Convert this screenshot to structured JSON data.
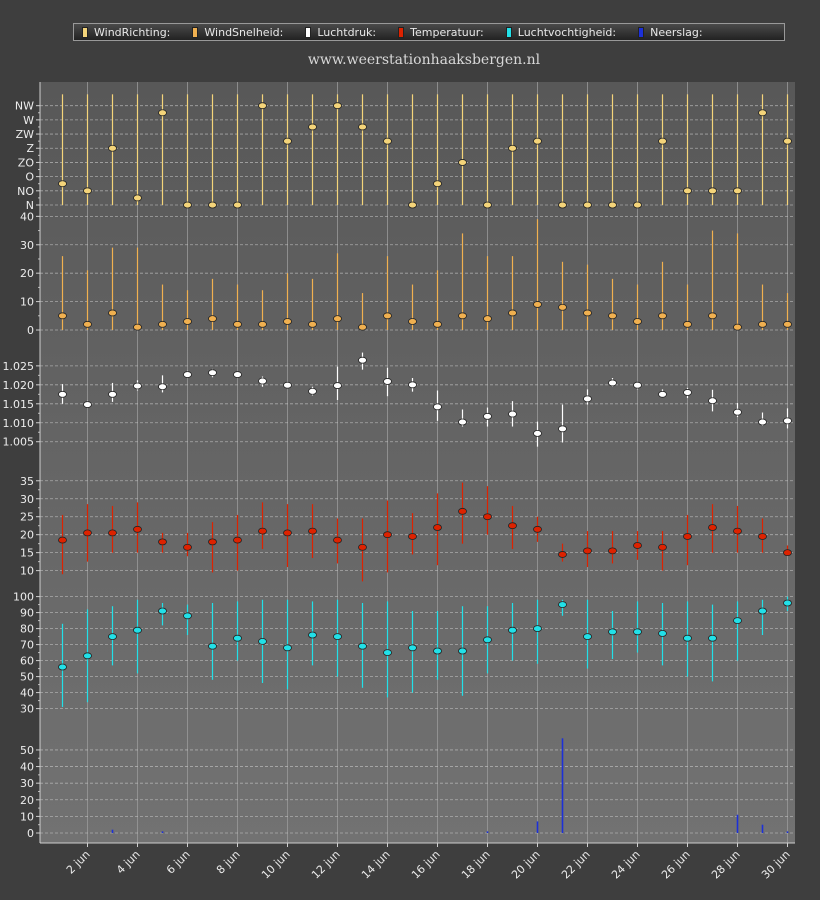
{
  "site_title": "www.weerstationhaaksbergen.nl",
  "legend": [
    {
      "label": "WindRichting:",
      "color": "#f4d47a"
    },
    {
      "label": "WindSnelheid:",
      "color": "#f0b050"
    },
    {
      "label": "Luchtdruk:",
      "color": "#ffffff"
    },
    {
      "label": "Temperatuur:",
      "color": "#dd2200"
    },
    {
      "label": "Luchtvochtigheid:",
      "color": "#22e0e8"
    },
    {
      "label": "Neerslag:",
      "color": "#1c30d8"
    }
  ],
  "chart_data": {
    "type": "scatter",
    "x": [
      1,
      2,
      3,
      4,
      5,
      6,
      7,
      8,
      9,
      10,
      11,
      12,
      13,
      14,
      15,
      16,
      17,
      18,
      19,
      20,
      21,
      22,
      23,
      24,
      25,
      26,
      27,
      28,
      29,
      30
    ],
    "x_tick_labels": [
      "2 jun",
      "4 jun",
      "6 jun",
      "8 jun",
      "10 jun",
      "12 jun",
      "14 jun",
      "16 jun",
      "18 jun",
      "20 jun",
      "22 jun",
      "24 jun",
      "26 jun",
      "28 jun",
      "30 jun"
    ],
    "x_tick_values": [
      2,
      4,
      6,
      8,
      10,
      12,
      14,
      16,
      18,
      20,
      22,
      24,
      26,
      28,
      30
    ],
    "xlim": [
      0.1,
      30.3
    ],
    "grid": true,
    "panels": [
      {
        "name": "WindRichting",
        "kind": "range-dot",
        "color": "#f4d47a",
        "ylim": [
          0,
          7.4
        ],
        "y_tick_labels": [
          "N",
          "NO",
          "O",
          "ZO",
          "Z",
          "ZW",
          "W",
          "NW"
        ],
        "y_tick_values": [
          0,
          1,
          2,
          3,
          4,
          5,
          6,
          7
        ],
        "values": [
          1.5,
          1,
          4,
          0.5,
          6.5,
          0,
          0,
          0,
          7,
          4.5,
          5.5,
          7,
          5.5,
          4.5,
          0,
          1.5,
          3,
          0,
          4,
          4.5,
          0,
          0,
          0,
          0,
          4.5,
          1,
          1,
          1,
          6.5,
          4.5
        ],
        "low": [
          0,
          0,
          0,
          0,
          0,
          0,
          0,
          0,
          0,
          0,
          0,
          0,
          0,
          0,
          0,
          0,
          0,
          0,
          0,
          0,
          0,
          0,
          0,
          0,
          0,
          0,
          0,
          0,
          0,
          0
        ],
        "high": [
          7.8,
          7.8,
          7.8,
          7.8,
          7.8,
          7.8,
          7.8,
          7.8,
          7.8,
          7.8,
          7.8,
          7.8,
          7.8,
          7.8,
          7.8,
          7.8,
          7.8,
          7.8,
          7.8,
          7.8,
          7.8,
          7.8,
          7.8,
          7.8,
          7.8,
          7.8,
          7.8,
          7.8,
          7.8,
          7.8
        ]
      },
      {
        "name": "WindSnelheid",
        "kind": "range-dot",
        "color": "#f0b050",
        "ylim": [
          0,
          44
        ],
        "y_tick_labels": [
          "0",
          "10",
          "20",
          "30",
          "40"
        ],
        "y_tick_values": [
          0,
          10,
          20,
          30,
          40
        ],
        "values": [
          5,
          2,
          6,
          1,
          2,
          3,
          4,
          2,
          2,
          3,
          2,
          4,
          1,
          5,
          3,
          2,
          5,
          4,
          6,
          9,
          8,
          6,
          5,
          3,
          5,
          2,
          5,
          1,
          2,
          2
        ],
        "low": [
          0,
          0,
          0,
          0,
          0,
          0,
          0,
          0,
          0,
          0,
          0,
          0,
          0,
          0,
          0,
          0,
          0,
          0,
          0,
          0,
          0,
          0,
          0,
          0,
          0,
          0,
          0,
          0,
          0,
          0
        ],
        "high": [
          26,
          21,
          29,
          29,
          16,
          14,
          18,
          16,
          14,
          20,
          18,
          27,
          13,
          26,
          16,
          21,
          34,
          26,
          26,
          39,
          24,
          23,
          18,
          16,
          24,
          16,
          35,
          34,
          16,
          13
        ]
      },
      {
        "name": "Luchtdruk",
        "kind": "range-dot",
        "color": "#ffffff",
        "ylim": [
          1.0015,
          1.0305
        ],
        "y_tick_labels": [
          "1.005",
          "1.010",
          "1.015",
          "1.020",
          "1.025"
        ],
        "y_tick_values": [
          1.005,
          1.01,
          1.015,
          1.02,
          1.025
        ],
        "values": [
          1.0175,
          1.0148,
          1.0175,
          1.0197,
          1.0195,
          1.0227,
          1.0232,
          1.0227,
          1.021,
          1.0199,
          1.0183,
          1.0198,
          1.0265,
          1.0209,
          1.02,
          1.0142,
          1.0102,
          1.0117,
          1.0123,
          1.0072,
          1.0084,
          1.0163,
          1.0205,
          1.0199,
          1.0175,
          1.018,
          1.0158,
          1.0128,
          1.0102,
          1.0105
        ],
        "low": [
          1.015,
          1.014,
          1.0155,
          1.0185,
          1.018,
          1.022,
          1.022,
          1.022,
          1.0195,
          1.0192,
          1.0172,
          1.016,
          1.024,
          1.017,
          1.0182,
          1.0105,
          1.009,
          1.009,
          1.009,
          1.0037,
          1.0048,
          1.0148,
          1.0195,
          1.0188,
          1.0168,
          1.0165,
          1.013,
          1.0115,
          1.0092,
          1.0085
        ],
        "high": [
          1.0202,
          1.0158,
          1.0205,
          1.0212,
          1.0225,
          1.0237,
          1.0242,
          1.0232,
          1.0222,
          1.0208,
          1.0195,
          1.0248,
          1.0285,
          1.0245,
          1.0218,
          1.0185,
          1.0135,
          1.014,
          1.0157,
          1.0103,
          1.0148,
          1.0188,
          1.0218,
          1.0205,
          1.0188,
          1.0192,
          1.0187,
          1.0152,
          1.0127,
          1.0138
        ]
      },
      {
        "name": "Temperatuur",
        "kind": "range-dot",
        "color": "#dd2200",
        "ylim": [
          6,
          38
        ],
        "y_tick_labels": [
          "10",
          "15",
          "20",
          "25",
          "30",
          "35"
        ],
        "y_tick_values": [
          10,
          15,
          20,
          25,
          30,
          35
        ],
        "values": [
          18.5,
          20.5,
          20.5,
          21.5,
          18,
          16.5,
          18,
          18.5,
          21,
          20.5,
          21,
          18.5,
          16.5,
          20,
          19.5,
          22,
          26.5,
          25,
          22.5,
          21.5,
          14.5,
          15.5,
          15.5,
          17,
          16.5,
          19.5,
          22,
          21,
          19.5,
          15
        ],
        "low": [
          9,
          12.5,
          15,
          15,
          15,
          14,
          9.5,
          10,
          16,
          11,
          13.5,
          12,
          7,
          9.5,
          14.5,
          11.5,
          17.5,
          20,
          16,
          18,
          12.5,
          11,
          12,
          13,
          10,
          11.5,
          15,
          15,
          15,
          14.5
        ],
        "high": [
          25.5,
          28.5,
          28,
          29,
          20.5,
          20.5,
          23.5,
          25.5,
          29,
          28.5,
          28.5,
          24.5,
          24.5,
          29.5,
          26,
          31.5,
          34.5,
          33.5,
          28,
          25,
          17.5,
          21,
          21,
          21,
          21,
          25.5,
          28.5,
          28,
          24.5,
          17
        ]
      },
      {
        "name": "Luchtvochtigheid",
        "kind": "range-dot",
        "color": "#22e0e8",
        "ylim": [
          26,
          101
        ],
        "y_tick_labels": [
          "30",
          "40",
          "50",
          "60",
          "70",
          "80",
          "90",
          "100"
        ],
        "y_tick_values": [
          30,
          40,
          50,
          60,
          70,
          80,
          90,
          100
        ],
        "values": [
          56,
          63,
          75,
          79,
          91,
          88,
          69,
          74,
          72,
          68,
          76,
          75,
          69,
          65,
          68,
          66,
          66,
          73,
          79,
          80,
          95,
          75,
          78,
          78,
          77,
          74,
          74,
          85,
          91,
          96
        ],
        "low": [
          31,
          34,
          57,
          52,
          82,
          76,
          48,
          60,
          46,
          42,
          57,
          50,
          43,
          37,
          40,
          48,
          38,
          52,
          60,
          58,
          88,
          55,
          61,
          65,
          57,
          50,
          47,
          60,
          76,
          91
        ],
        "high": [
          83,
          92,
          94,
          98,
          96,
          95,
          96,
          97,
          98,
          98,
          97,
          98,
          96,
          97,
          91,
          91,
          94,
          94,
          96,
          98,
          98,
          98,
          91,
          97,
          96,
          97,
          95,
          97,
          98,
          100
        ]
      },
      {
        "name": "Neerslag",
        "kind": "bar",
        "color": "#1c30d8",
        "ylim": [
          -3,
          62
        ],
        "y_tick_labels": [
          "0",
          "10",
          "20",
          "30",
          "40",
          "50"
        ],
        "y_tick_values": [
          0,
          10,
          20,
          30,
          40,
          50
        ],
        "values": [
          0,
          0,
          2,
          0,
          1,
          0,
          0,
          0,
          0,
          0,
          0,
          0,
          0,
          0,
          0,
          0,
          0,
          1,
          0,
          7,
          57,
          0,
          0,
          0,
          0,
          0,
          0,
          11,
          5,
          1
        ]
      }
    ]
  }
}
